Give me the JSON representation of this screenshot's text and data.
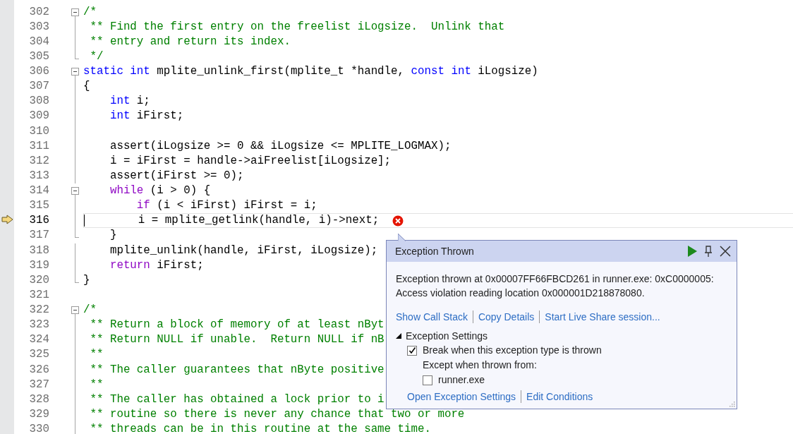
{
  "editor": {
    "lines": [
      {
        "number": "302",
        "current": false,
        "error": false,
        "kind": "fold_start",
        "tokens": [
          {
            "kind": "comment",
            "text": "/*"
          }
        ]
      },
      {
        "number": "303",
        "current": false,
        "error": false,
        "kind": "fold_inner",
        "tokens": [
          {
            "kind": "comment",
            "text": " ** Find the first entry on the freelist iLogsize.  Unlink that"
          }
        ]
      },
      {
        "number": "304",
        "current": false,
        "error": false,
        "kind": "fold_inner",
        "tokens": [
          {
            "kind": "comment",
            "text": " ** entry and return its index."
          }
        ]
      },
      {
        "number": "305",
        "current": false,
        "error": false,
        "kind": "fold_end",
        "tokens": [
          {
            "kind": "comment",
            "text": " */"
          }
        ]
      },
      {
        "number": "306",
        "current": false,
        "error": false,
        "kind": "fold_start",
        "tokens": [
          {
            "kind": "keyword",
            "text": "static"
          },
          {
            "kind": "keyword",
            "text": " int"
          },
          {
            "kind": "plain",
            "text": " mplite_unlink_first(mplite_t *handle, "
          },
          {
            "kind": "keyword",
            "text": "const"
          },
          {
            "kind": "keyword",
            "text": " int"
          },
          {
            "kind": "plain",
            "text": " iLogsize)"
          }
        ]
      },
      {
        "number": "307",
        "current": false,
        "error": false,
        "kind": "fold_inner",
        "tokens": [
          {
            "kind": "plain",
            "text": "{"
          }
        ]
      },
      {
        "number": "308",
        "current": false,
        "error": false,
        "kind": "fold_inner",
        "tokens": [
          {
            "kind": "keyword",
            "text": "    int"
          },
          {
            "kind": "plain",
            "text": " i;"
          }
        ]
      },
      {
        "number": "309",
        "current": false,
        "error": false,
        "kind": "fold_inner",
        "tokens": [
          {
            "kind": "keyword",
            "text": "    int"
          },
          {
            "kind": "plain",
            "text": " iFirst;"
          }
        ]
      },
      {
        "number": "310",
        "current": false,
        "error": false,
        "kind": "fold_inner"
      },
      {
        "number": "311",
        "current": false,
        "error": false,
        "kind": "fold_inner",
        "tokens": [
          {
            "kind": "plain",
            "text": "    assert(iLogsize >= 0 && iLogsize <= MPLITE_LOGMAX);"
          }
        ]
      },
      {
        "number": "312",
        "current": false,
        "error": false,
        "kind": "fold_inner",
        "tokens": [
          {
            "kind": "plain",
            "text": "    i = iFirst = handle->aiFreelist[iLogsize];"
          }
        ]
      },
      {
        "number": "313",
        "current": false,
        "error": false,
        "kind": "fold_inner",
        "tokens": [
          {
            "kind": "plain",
            "text": "    assert(iFirst >= 0);"
          }
        ]
      },
      {
        "number": "314",
        "current": false,
        "error": false,
        "kind": "fold_start",
        "tokens": [
          {
            "kind": "control",
            "text": "    while"
          },
          {
            "kind": "plain",
            "text": " (i > 0) {"
          }
        ]
      },
      {
        "number": "315",
        "current": false,
        "error": false,
        "kind": "fold_inner",
        "tokens": [
          {
            "kind": "control",
            "text": "        if"
          },
          {
            "kind": "plain",
            "text": " (i < iFirst) iFirst = i;"
          }
        ]
      },
      {
        "number": "316",
        "current": true,
        "error": true,
        "kind": "fold_inner",
        "tokens": [
          {
            "kind": "plain",
            "text": "        i = mplite_getlink(handle, i)->next;"
          }
        ]
      },
      {
        "number": "317",
        "current": false,
        "error": false,
        "kind": "fold_end",
        "tokens": [
          {
            "kind": "plain",
            "text": "    }"
          }
        ]
      },
      {
        "number": "318",
        "current": false,
        "error": false,
        "kind": "fold_inner",
        "tokens": [
          {
            "kind": "plain",
            "text": "    mplite_unlink(handle, iFirst, iLogsize);"
          }
        ]
      },
      {
        "number": "319",
        "current": false,
        "error": false,
        "kind": "fold_inner",
        "tokens": [
          {
            "kind": "control",
            "text": "    return"
          },
          {
            "kind": "plain",
            "text": " iFirst;"
          }
        ]
      },
      {
        "number": "320",
        "current": false,
        "error": false,
        "kind": "fold_end",
        "tokens": [
          {
            "kind": "plain",
            "text": "}"
          }
        ]
      },
      {
        "number": "321",
        "current": false,
        "error": false,
        "kind": "plain"
      },
      {
        "number": "322",
        "current": false,
        "error": false,
        "kind": "fold_start",
        "tokens": [
          {
            "kind": "comment",
            "text": "/*"
          }
        ]
      },
      {
        "number": "323",
        "current": false,
        "error": false,
        "kind": "fold_inner",
        "tokens": [
          {
            "kind": "comment",
            "text": " ** Return a block of memory of at least nByt"
          }
        ]
      },
      {
        "number": "324",
        "current": false,
        "error": false,
        "kind": "fold_inner",
        "tokens": [
          {
            "kind": "comment",
            "text": " ** Return NULL if unable.  Return NULL if nB"
          }
        ]
      },
      {
        "number": "325",
        "current": false,
        "error": false,
        "kind": "fold_inner",
        "tokens": [
          {
            "kind": "comment",
            "text": " **"
          }
        ]
      },
      {
        "number": "326",
        "current": false,
        "error": false,
        "kind": "fold_inner",
        "tokens": [
          {
            "kind": "comment",
            "text": " ** The caller guarantees that nByte positive"
          }
        ]
      },
      {
        "number": "327",
        "current": false,
        "error": false,
        "kind": "fold_inner",
        "tokens": [
          {
            "kind": "comment",
            "text": " **"
          }
        ]
      },
      {
        "number": "328",
        "current": false,
        "error": false,
        "kind": "fold_inner",
        "tokens": [
          {
            "kind": "comment",
            "text": " ** The caller has obtained a lock prior to i"
          }
        ]
      },
      {
        "number": "329",
        "current": false,
        "error": false,
        "kind": "fold_inner",
        "tokens": [
          {
            "kind": "comment",
            "text": " ** routine so there is never any chance that two or more"
          }
        ]
      },
      {
        "number": "330",
        "current": false,
        "error": false,
        "kind": "fold_inner",
        "tokens": [
          {
            "kind": "comment",
            "text": " ** threads can be in this routine at the same time."
          }
        ]
      }
    ]
  },
  "exception_popup": {
    "title": "Exception Thrown",
    "message_lines": [
      "Exception thrown at 0x00007FF66FBCD261 in runner.exe: 0xC0000005:",
      "Access violation reading location 0x000001D218878080."
    ],
    "links": [
      "Show Call Stack",
      "Copy Details",
      "Start Live Share session..."
    ],
    "settings": {
      "label": "Exception Settings",
      "expanded": true,
      "break_option": {
        "label": "Break when this exception type is thrown",
        "checked": true
      },
      "except_label": "Except when thrown from:",
      "modules": [
        {
          "label": "runner.exe",
          "checked": false
        }
      ],
      "links": [
        "Open Exception Settings",
        "Edit Conditions"
      ]
    }
  }
}
